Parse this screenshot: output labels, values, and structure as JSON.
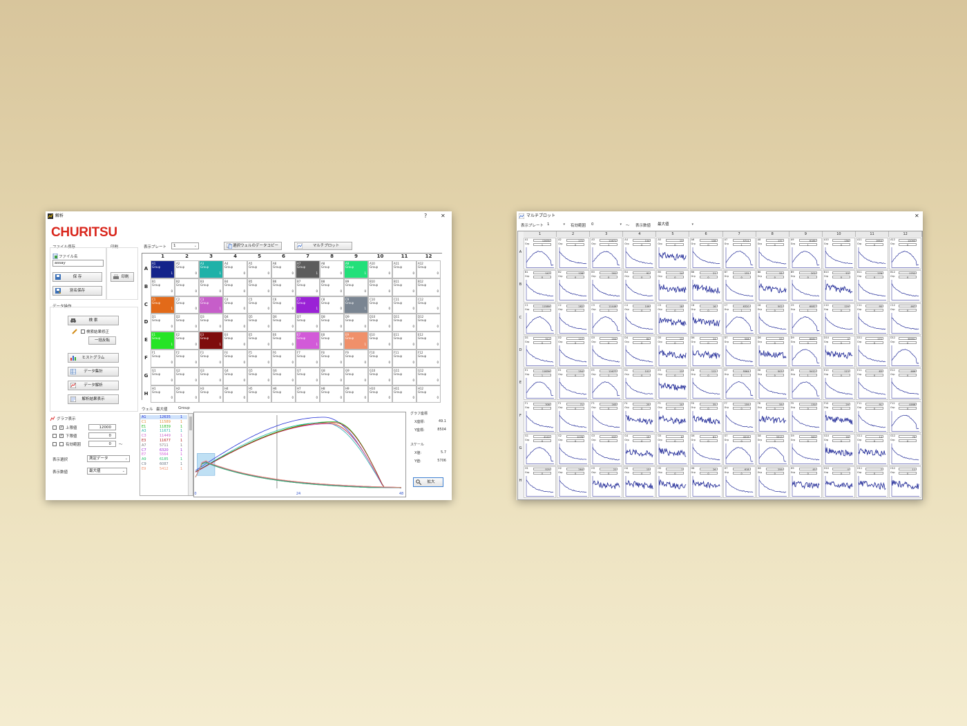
{
  "analysis_window": {
    "title": "解析",
    "help_glyph": "?",
    "close_glyph": "✕",
    "logo": "CHURITSU",
    "file_save_label": "ファイル保存",
    "print_group_label": "印刷",
    "file_name_label": "ファイル名",
    "file_name_value": "assay",
    "save_button": "保 存",
    "save_as_button": "別名保存",
    "print_button": "印刷",
    "data_ops_label": "データ操作",
    "search_button": "検 索",
    "search_result_fix_label": "検索結果修正",
    "bulk_invert_button": "一括反転",
    "histogram_button": "ヒストグラム",
    "data_aggregate_button": "データ集計",
    "data_analysis_button": "データ解析",
    "analysis_result_button": "解析結果表示",
    "graph_display_label": "グラフ表示",
    "upper_limit_label": "上限値",
    "upper_limit_value": "12000",
    "lower_limit_label": "下限値",
    "lower_limit_value": "0",
    "valid_range_label": "有効範囲",
    "valid_range_value": "0",
    "tilde": "〜",
    "display_select_label": "表示選択",
    "display_select_value": "測定データ",
    "display_value_label": "表示数値",
    "display_value_value": "最大値",
    "display_plate_label": "表示プレート",
    "display_plate_value": "1",
    "copy_selected_button": "選択ウェルのデータコピー",
    "multiplot_button": "マルチプロット",
    "columns": [
      "1",
      "2",
      "3",
      "4",
      "5",
      "6",
      "7",
      "8",
      "9",
      "10",
      "11",
      "12"
    ],
    "rows": [
      "A",
      "B",
      "C",
      "D",
      "E",
      "F",
      "G",
      "H"
    ],
    "group_word": "Group",
    "colored_cells": [
      {
        "well": "A1",
        "color": "#13238a",
        "group": "1"
      },
      {
        "well": "A3",
        "color": "#1fb1a8",
        "group": "1"
      },
      {
        "well": "A7",
        "color": "#5c5c5c",
        "group": "1"
      },
      {
        "well": "A9",
        "color": "#22e07a",
        "group": "1"
      },
      {
        "well": "C1",
        "color": "#e26a19",
        "group": "1"
      },
      {
        "well": "C3",
        "color": "#c65ec9",
        "group": "1"
      },
      {
        "well": "C7",
        "color": "#9a22d6",
        "group": "1"
      },
      {
        "well": "C9",
        "color": "#7a8592",
        "group": "1"
      },
      {
        "well": "E1",
        "color": "#25e425",
        "group": "1"
      },
      {
        "well": "E3",
        "color": "#7e0c0c",
        "group": "1"
      },
      {
        "well": "E7",
        "color": "#d25ad8",
        "group": "1"
      },
      {
        "well": "E9",
        "color": "#f0906a",
        "group": "1"
      }
    ],
    "list_headers": {
      "well": "ウェル",
      "max": "最大値",
      "group": "Group"
    },
    "list_rows": [
      {
        "well": "A1",
        "value": "12635",
        "group": "1",
        "color": "#1d2bd6"
      },
      {
        "well": "C1",
        "value": "11589",
        "group": "1",
        "color": "#e2862e"
      },
      {
        "well": "E1",
        "value": "11839",
        "group": "1",
        "color": "#1bb81b"
      },
      {
        "well": "A3",
        "value": "11671",
        "group": "1",
        "color": "#1fb1a8"
      },
      {
        "well": "C3",
        "value": "11449",
        "group": "1",
        "color": "#c65ec9"
      },
      {
        "well": "E3",
        "value": "11677",
        "group": "1",
        "color": "#b31414"
      },
      {
        "well": "A7",
        "value": "5711",
        "group": "1",
        "color": "#777777"
      },
      {
        "well": "C7",
        "value": "6320",
        "group": "1",
        "color": "#9a22d6"
      },
      {
        "well": "E7",
        "value": "5564",
        "group": "1",
        "color": "#d25ad8"
      },
      {
        "well": "A9",
        "value": "6185",
        "group": "1",
        "color": "#22c06a"
      },
      {
        "well": "C9",
        "value": "6087",
        "group": "1",
        "color": "#6a7582"
      },
      {
        "well": "E9",
        "value": "5412",
        "group": "1",
        "color": "#f0906a"
      }
    ],
    "graph_x_ticks": [
      "0",
      "24",
      "48"
    ],
    "graph_coord_label": "グラフ座標",
    "x_coord_label": "X座標:",
    "x_coord_value": "49.1",
    "y_coord_label": "Y座標:",
    "y_coord_value": "8504",
    "scale_label": "スケール",
    "x_scale_label": "X値:",
    "x_scale_value": "5.7",
    "y_scale_label": "Y値:",
    "y_scale_value": "5706",
    "enlarge_button": "拡大"
  },
  "multiplot_window": {
    "title": "マルチプロット",
    "close_glyph": "✕",
    "display_plate_label": "表示プレート",
    "display_plate_value": "1",
    "valid_range_label": "有効範囲",
    "valid_range_value": "0",
    "tilde": "〜",
    "display_value_label": "表示数値",
    "display_value_value": "最大値",
    "grp_word": "Grp",
    "columns": [
      "1",
      "2",
      "3",
      "4",
      "5",
      "6",
      "7",
      "8",
      "9",
      "10",
      "11",
      "12"
    ],
    "rows": [
      "A",
      "B",
      "C",
      "D",
      "E",
      "F",
      "G",
      "H"
    ],
    "values": [
      [
        "12635",
        "272",
        "11671",
        "104",
        "13",
        "128",
        "5711",
        "137",
        "6185",
        "136",
        "1954",
        "12093"
      ],
      [
        "147",
        "128",
        "201",
        "91",
        "14",
        "21",
        "131",
        "55",
        "202",
        "53",
        "276",
        "1752"
      ],
      [
        "11589",
        "282",
        "11449",
        "109",
        "18",
        "16",
        "6320",
        "502",
        "6087",
        "129",
        "95",
        "467"
      ],
      [
        "312",
        "127",
        "204",
        "64",
        "13",
        "24",
        "508",
        "53",
        "6087",
        "4",
        "272",
        "35991"
      ],
      [
        "11839",
        "254",
        "11677",
        "101",
        "13",
        "112",
        "5564",
        "503",
        "5412",
        "113",
        "83",
        "469"
      ],
      [
        "308",
        "71",
        "163",
        "25",
        "10",
        "35",
        "159",
        "59",
        "130",
        "29",
        "91",
        "4466"
      ],
      [
        "4142",
        "1076",
        "937",
        "15",
        "8",
        "61",
        "4019",
        "3313",
        "363",
        "16",
        "14",
        "75"
      ],
      [
        "525",
        "264",
        "22",
        "13",
        "7",
        "26",
        "618",
        "259",
        "45",
        "4",
        "7",
        "11"
      ]
    ],
    "groups": [
      [
        "1",
        "0",
        "1",
        "0",
        "0",
        "0",
        "1",
        "0",
        "1",
        "0",
        "0",
        "0"
      ],
      [
        "0",
        "0",
        "0",
        "0",
        "0",
        "0",
        "0",
        "0",
        "0",
        "0",
        "0",
        "0"
      ],
      [
        "1",
        "0",
        "1",
        "0",
        "0",
        "0",
        "1",
        "0",
        "1",
        "0",
        "0",
        "0"
      ],
      [
        "0",
        "0",
        "0",
        "0",
        "0",
        "0",
        "0",
        "0",
        "0",
        "0",
        "0",
        "0"
      ],
      [
        "1",
        "0",
        "1",
        "0",
        "0",
        "0",
        "1",
        "0",
        "1",
        "0",
        "0",
        "0"
      ],
      [
        "0",
        "0",
        "0",
        "0",
        "0",
        "0",
        "0",
        "0",
        "0",
        "0",
        "0",
        "0"
      ],
      [
        "0",
        "0",
        "0",
        "0",
        "0",
        "0",
        "0",
        "0",
        "0",
        "0",
        "0",
        "0"
      ],
      [
        "0",
        "0",
        "0",
        "0",
        "0",
        "0",
        "0",
        "0",
        "0",
        "0",
        "0",
        "0"
      ]
    ]
  }
}
